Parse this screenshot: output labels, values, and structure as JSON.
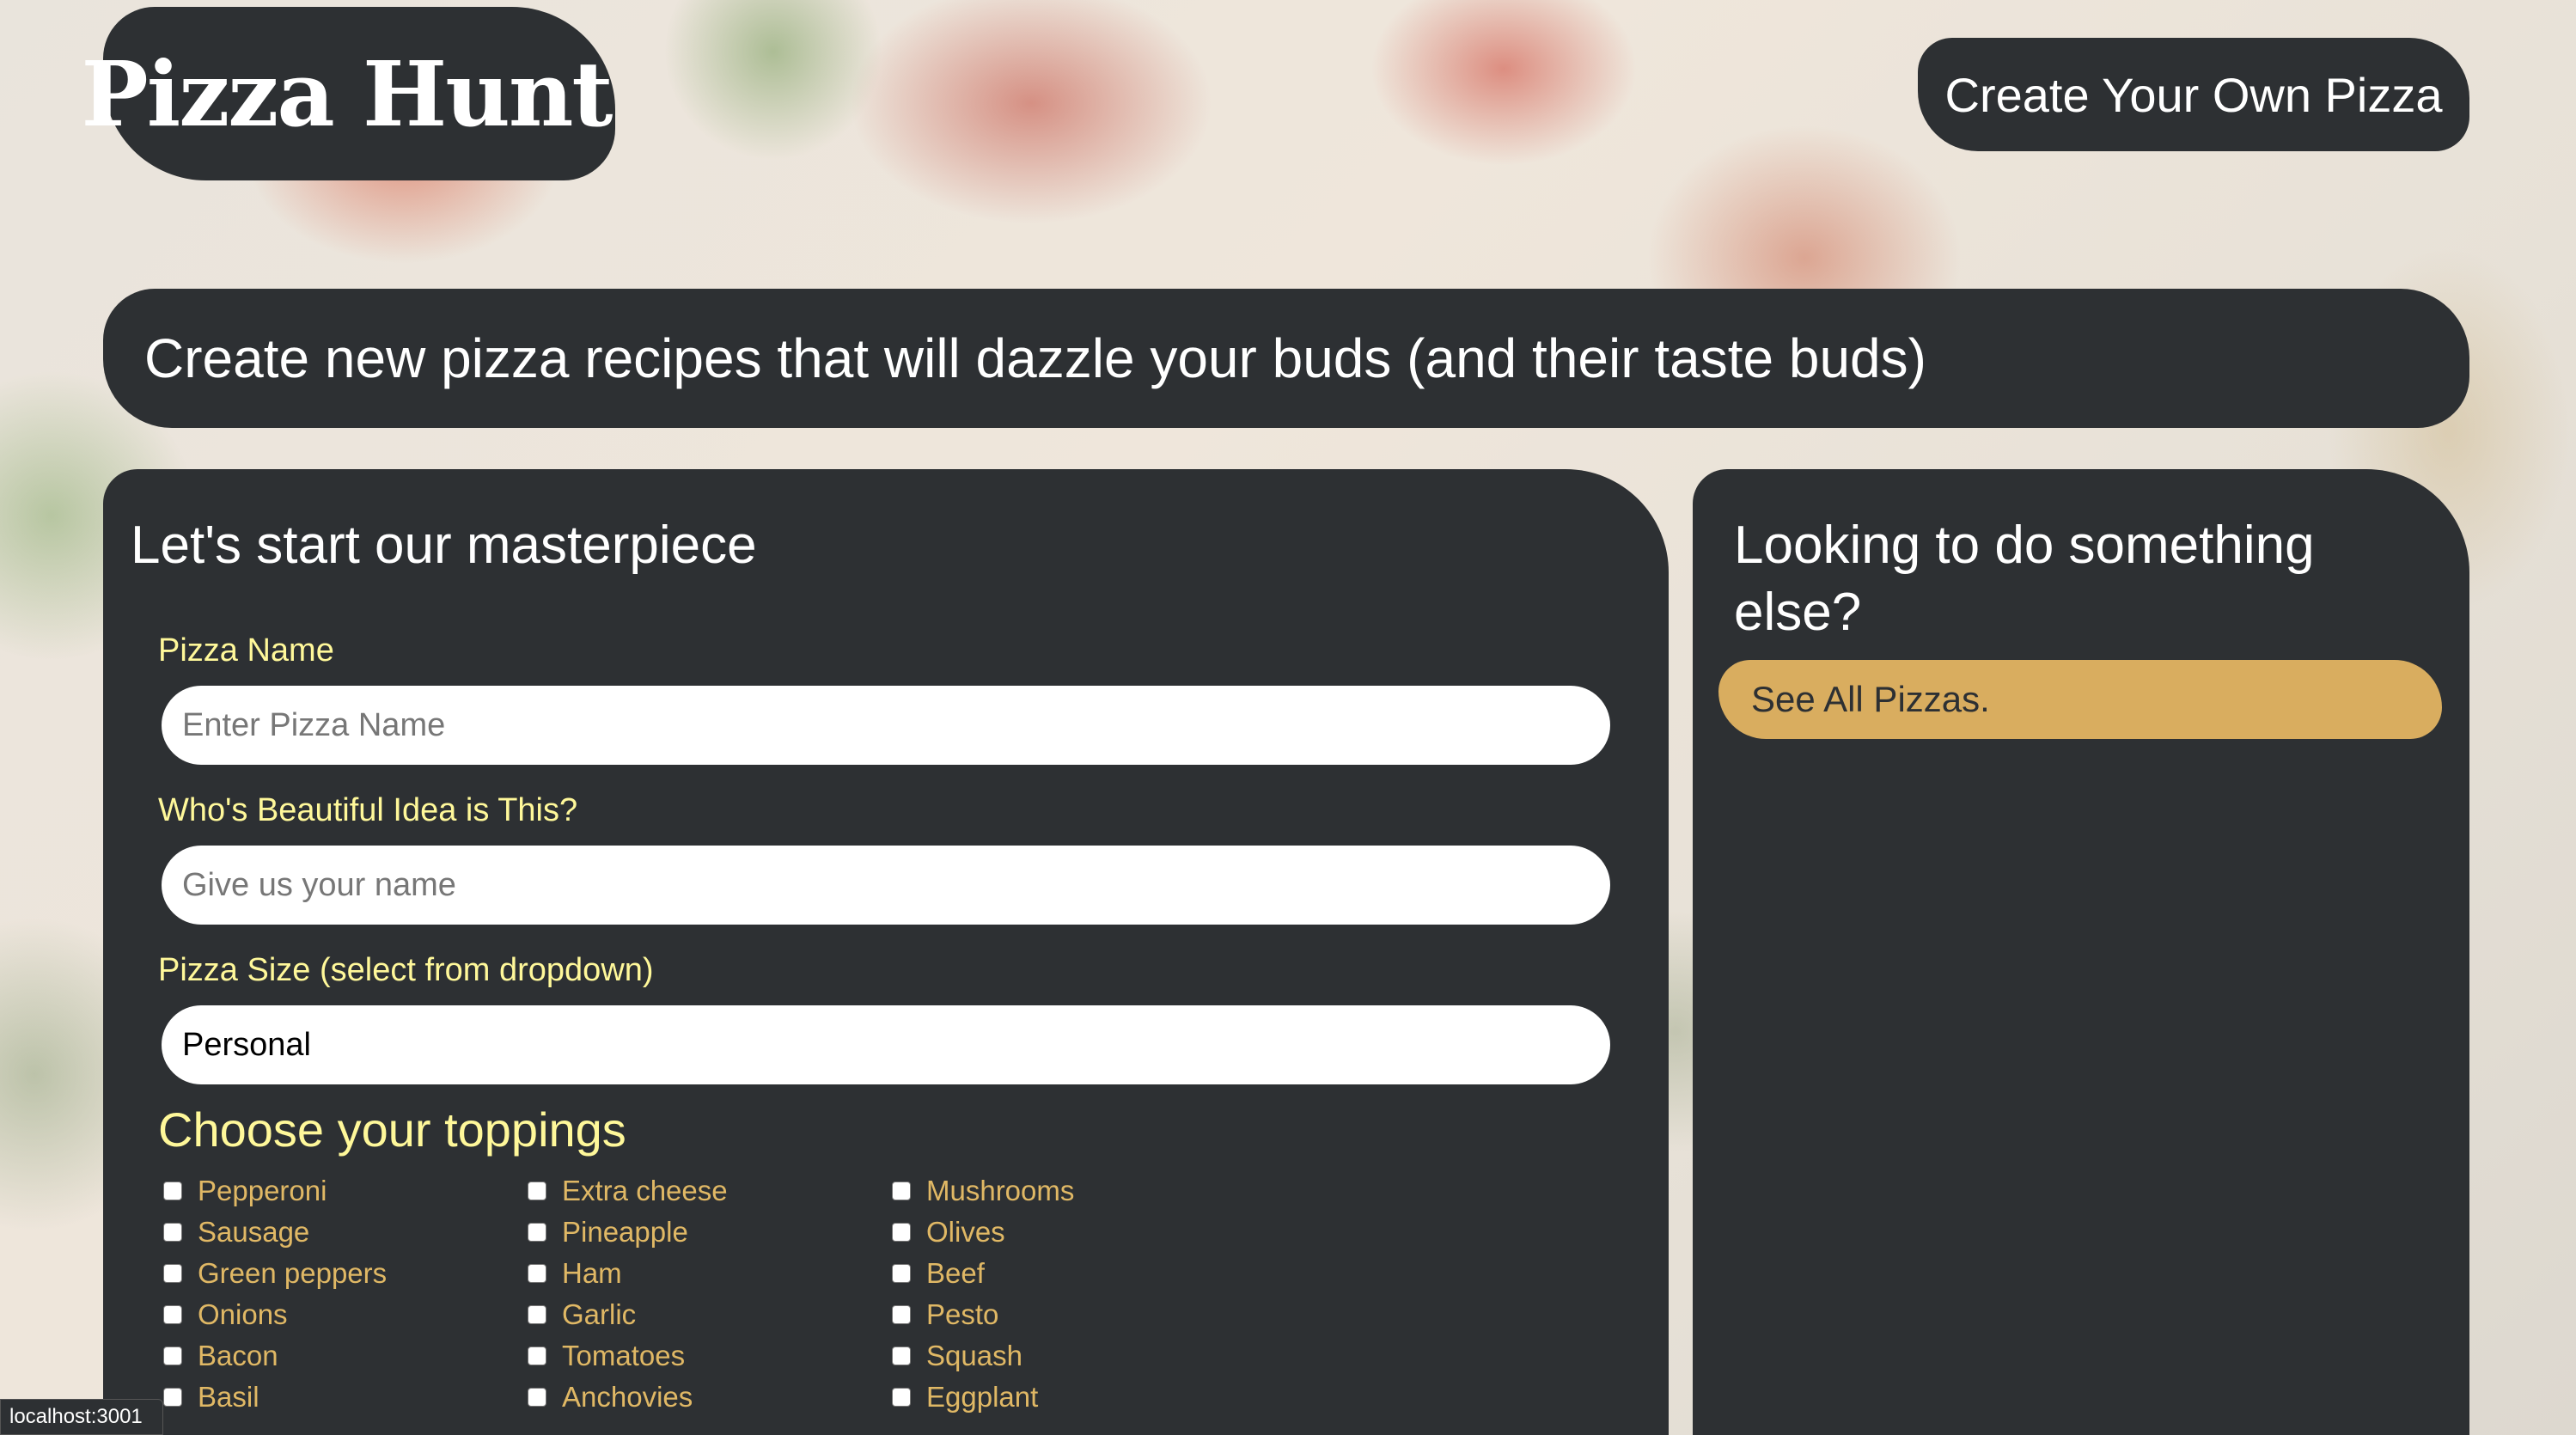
{
  "header": {
    "logo_text": "Pizza Hunt",
    "nav_button_label": "Create Your Own Pizza"
  },
  "hero": {
    "text": "Create new pizza recipes that will dazzle your buds (and their taste buds)"
  },
  "form": {
    "title": "Let's start our masterpiece",
    "pizza_name": {
      "label": "Pizza Name",
      "placeholder": "Enter Pizza Name"
    },
    "creator": {
      "label": "Who's Beautiful Idea is This?",
      "placeholder": "Give us your name"
    },
    "size": {
      "label": "Pizza Size (select from dropdown)",
      "value": "Personal"
    },
    "toppings_heading": "Choose your toppings",
    "toppings": [
      [
        "Pepperoni",
        "Sausage",
        "Green peppers",
        "Onions",
        "Bacon",
        "Basil"
      ],
      [
        "Extra cheese",
        "Pineapple",
        "Ham",
        "Garlic",
        "Tomatoes",
        "Anchovies"
      ],
      [
        "Mushrooms",
        "Olives",
        "Beef",
        "Pesto",
        "Squash",
        "Eggplant"
      ]
    ]
  },
  "sidebar": {
    "title": "Looking to do something else?",
    "link_label": "See All Pizzas."
  },
  "status_bar": {
    "url": "localhost:3001"
  },
  "colors": {
    "panel": "#2d3033",
    "label_yellow": "#fff89a",
    "topping_gold": "#e0b865",
    "button_gold": "#d9ad5f"
  }
}
